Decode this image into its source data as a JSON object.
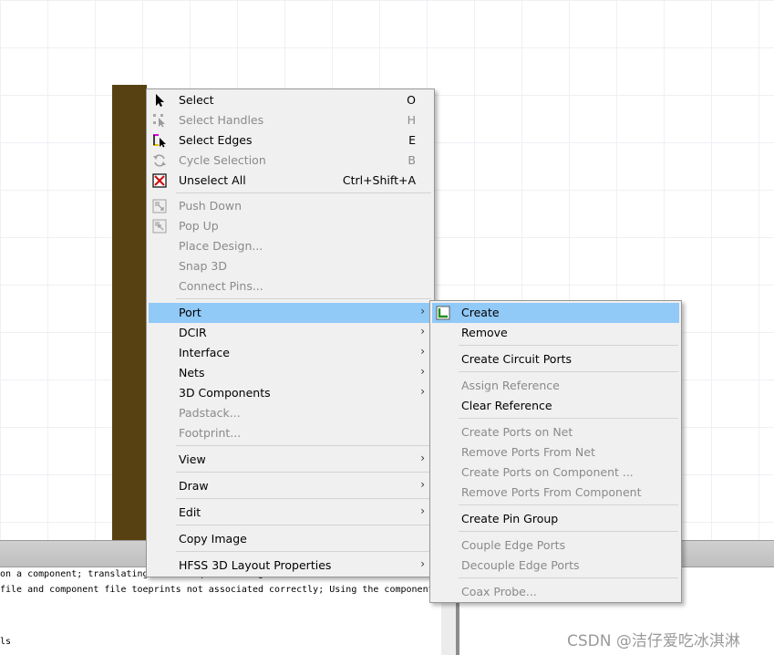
{
  "main_menu": {
    "items": [
      {
        "label": "Select",
        "shortcut": "O",
        "icon": "arrow-cursor-icon",
        "enabled": true
      },
      {
        "label": "Select Handles",
        "shortcut": "H",
        "icon": "select-handles-icon",
        "enabled": false
      },
      {
        "label": "Select Edges",
        "shortcut": "E",
        "icon": "select-edges-icon",
        "enabled": true
      },
      {
        "label": "Cycle Selection",
        "shortcut": "B",
        "icon": "cycle-icon",
        "enabled": false
      },
      {
        "label": "Unselect All",
        "shortcut": "Ctrl+Shift+A",
        "icon": "unselect-icon",
        "enabled": true
      },
      {
        "label": "Push Down",
        "icon": "push-down-icon",
        "enabled": false
      },
      {
        "label": "Pop Up",
        "icon": "pop-up-icon",
        "enabled": false
      },
      {
        "label": "Place Design...",
        "enabled": false
      },
      {
        "label": "Snap 3D",
        "enabled": false
      },
      {
        "label": "Connect Pins...",
        "enabled": false
      },
      {
        "label": "Port",
        "submenu": true,
        "enabled": true,
        "highlighted": true
      },
      {
        "label": "DCIR",
        "submenu": true,
        "enabled": true
      },
      {
        "label": "Interface",
        "submenu": true,
        "enabled": true
      },
      {
        "label": "Nets",
        "submenu": true,
        "enabled": true
      },
      {
        "label": "3D Components",
        "submenu": true,
        "enabled": true
      },
      {
        "label": "Padstack...",
        "enabled": false
      },
      {
        "label": "Footprint...",
        "enabled": false
      },
      {
        "label": "View",
        "submenu": true,
        "enabled": true
      },
      {
        "label": "Draw",
        "submenu": true,
        "enabled": true
      },
      {
        "label": "Edit",
        "submenu": true,
        "enabled": true
      },
      {
        "label": "Copy Image",
        "enabled": true
      },
      {
        "label": "HFSS 3D Layout Properties",
        "submenu": true,
        "enabled": true
      }
    ]
  },
  "port_submenu": {
    "items": [
      {
        "label": "Create",
        "icon": "create-port-icon",
        "enabled": true,
        "highlighted": true
      },
      {
        "label": "Remove",
        "enabled": true
      },
      {
        "label": "Create Circuit Ports",
        "enabled": true
      },
      {
        "label": "Assign Reference",
        "enabled": false
      },
      {
        "label": "Clear Reference",
        "enabled": true
      },
      {
        "label": "Create Ports on Net",
        "enabled": false
      },
      {
        "label": "Remove Ports From Net",
        "enabled": false
      },
      {
        "label": "Create Ports on Component ...",
        "enabled": false
      },
      {
        "label": "Remove Ports From Component",
        "enabled": false
      },
      {
        "label": "Create Pin Group",
        "enabled": true
      },
      {
        "label": "Couple Edge Ports",
        "enabled": false
      },
      {
        "label": "Decouple Edge Ports",
        "enabled": false
      },
      {
        "label": "Coax Probe...",
        "enabled": false
      }
    ]
  },
  "message_log": {
    "lines": [
      "on a component; translating with unique renaming.",
      "file and component file toeprints not associated correctly; Using the component",
      "ls"
    ]
  },
  "watermark": "CSDN @洁仔爱吃冰淇淋",
  "colors": {
    "highlight": "#91c9f7",
    "menu_bg": "#f0f0f0",
    "disabled_text": "#8a8a8a",
    "layout_block": "#574112"
  }
}
